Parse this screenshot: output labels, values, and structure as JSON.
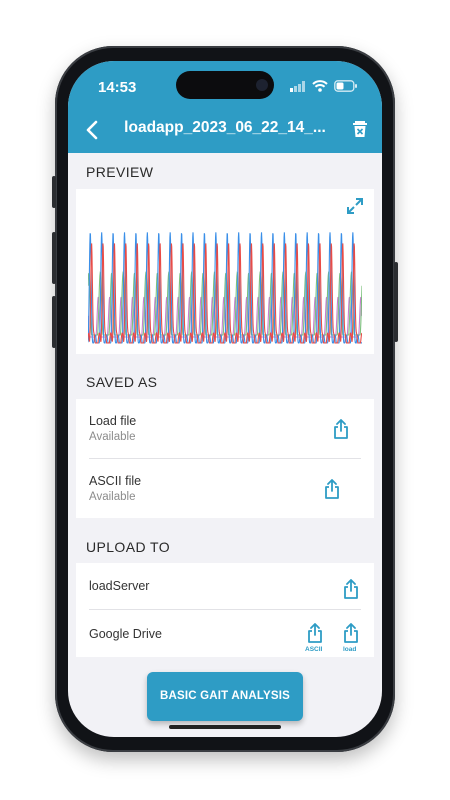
{
  "status_bar": {
    "time": "14:53"
  },
  "header": {
    "title": "loadapp_2023_06_22_14_..."
  },
  "preview": {
    "heading": "PREVIEW",
    "expand_icon": "expand-icon",
    "colors": [
      "#e94b46",
      "#3a8fe8",
      "#7cc07d",
      "#c77fd0"
    ]
  },
  "saved_as": {
    "heading": "SAVED AS",
    "items": [
      {
        "title": "Load file",
        "status": "Available"
      },
      {
        "title": "ASCII file",
        "status": "Available"
      }
    ]
  },
  "upload_to": {
    "heading": "UPLOAD TO",
    "items": [
      {
        "title": "loadServer"
      },
      {
        "title": "Google Drive",
        "actions": [
          "ASCII",
          "load"
        ]
      }
    ]
  },
  "cta_label": "BASIC GAIT ANALYSIS",
  "accent_color": "#2e9cc5"
}
